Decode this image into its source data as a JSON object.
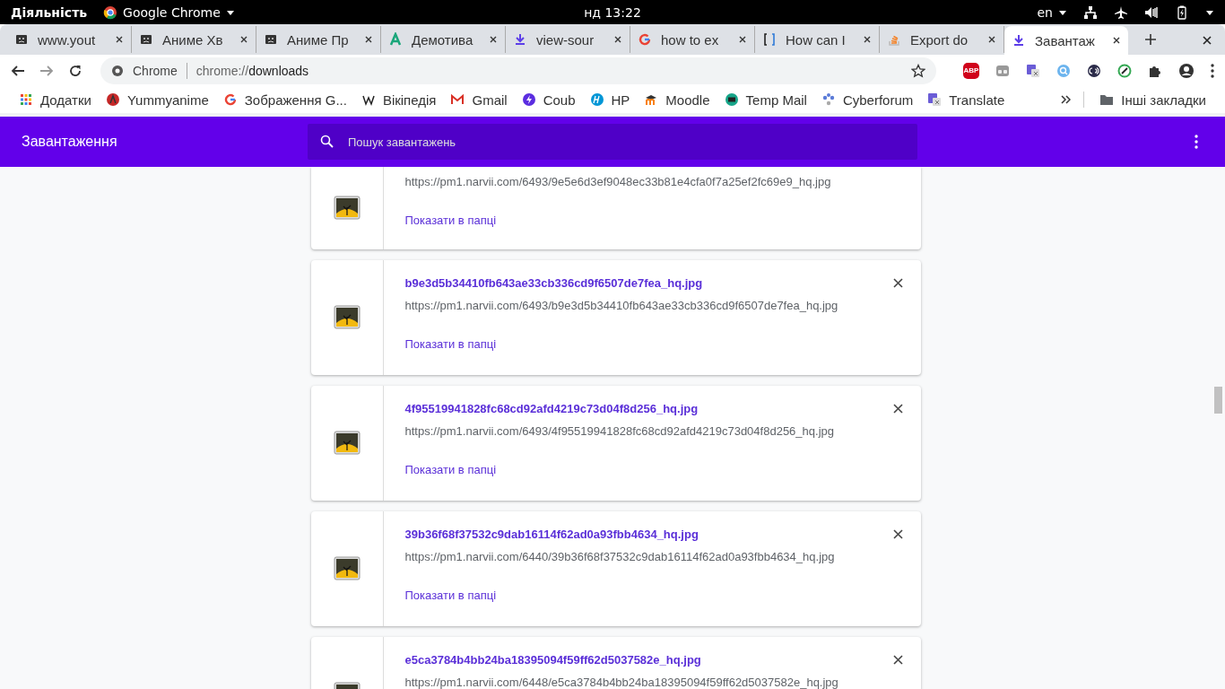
{
  "system_bar": {
    "activities": "Діяльність",
    "app": "Google Chrome",
    "clock": "нд 13:22",
    "language": "en"
  },
  "tabs": [
    {
      "title": "www.yout",
      "kind": "error",
      "selected": false
    },
    {
      "title": "Аниме Хв",
      "kind": "error",
      "selected": false
    },
    {
      "title": "Аниме Пр",
      "kind": "error",
      "selected": false
    },
    {
      "title": "Демотива",
      "kind": "letter",
      "selected": false
    },
    {
      "title": "view-sour",
      "kind": "download",
      "selected": false
    },
    {
      "title": "how to ex",
      "kind": "google",
      "selected": false
    },
    {
      "title": "How can I",
      "kind": "bracket",
      "selected": false
    },
    {
      "title": "Export do",
      "kind": "stack",
      "selected": false
    },
    {
      "title": "Завантаж",
      "kind": "download",
      "selected": true
    }
  ],
  "address_bar": {
    "site": "Chrome",
    "url_scheme": "chrome://",
    "url_path": "downloads"
  },
  "extensions": {
    "adblock_label": "ABP"
  },
  "bookmarks": [
    {
      "label": "Додатки",
      "kind": "apps"
    },
    {
      "label": "Yummyanime",
      "kind": "circle"
    },
    {
      "label": "Зображення G...",
      "kind": "google"
    },
    {
      "label": "Вікіпедія",
      "kind": "wiki"
    },
    {
      "label": "Gmail",
      "kind": "gmail"
    },
    {
      "label": "Coub",
      "kind": "coub"
    },
    {
      "label": "HP",
      "kind": "hp"
    },
    {
      "label": "Moodle",
      "kind": "moodle"
    },
    {
      "label": "Temp Mail",
      "kind": "mail"
    },
    {
      "label": "Cyberforum",
      "kind": "dots"
    },
    {
      "label": "Translate",
      "kind": "translate"
    }
  ],
  "other_bookmarks": "Інші закладки",
  "header": {
    "title": "Завантаження",
    "search_placeholder": "Пошук завантажень"
  },
  "downloads": [
    {
      "kind": "partial",
      "url": "https://pm1.narvii.com/6493/9e5e6d3ef9048ec33b81e4cfa0f7a25ef2fc69e9_hq.jpg",
      "action": "Показати в папці"
    },
    {
      "kind": "full",
      "name": "b9e3d5b34410fb643ae33cb336cd9f6507de7fea_hq.jpg",
      "url": "https://pm1.narvii.com/6493/b9e3d5b34410fb643ae33cb336cd9f6507de7fea_hq.jpg",
      "action": "Показати в папці"
    },
    {
      "kind": "full",
      "name": "4f95519941828fc68cd92afd4219c73d04f8d256_hq.jpg",
      "url": "https://pm1.narvii.com/6493/4f95519941828fc68cd92afd4219c73d04f8d256_hq.jpg",
      "action": "Показати в папці"
    },
    {
      "kind": "full",
      "name": "39b36f68f37532c9dab16114f62ad0a93fbb4634_hq.jpg",
      "url": "https://pm1.narvii.com/6440/39b36f68f37532c9dab16114f62ad0a93fbb4634_hq.jpg",
      "action": "Показати в папці"
    },
    {
      "kind": "full",
      "name": "e5ca3784b4bb24ba18395094f59ff62d5037582e_hq.jpg",
      "url": "https://pm1.narvii.com/6448/e5ca3784b4bb24ba18395094f59ff62d5037582e_hq.jpg"
    }
  ]
}
